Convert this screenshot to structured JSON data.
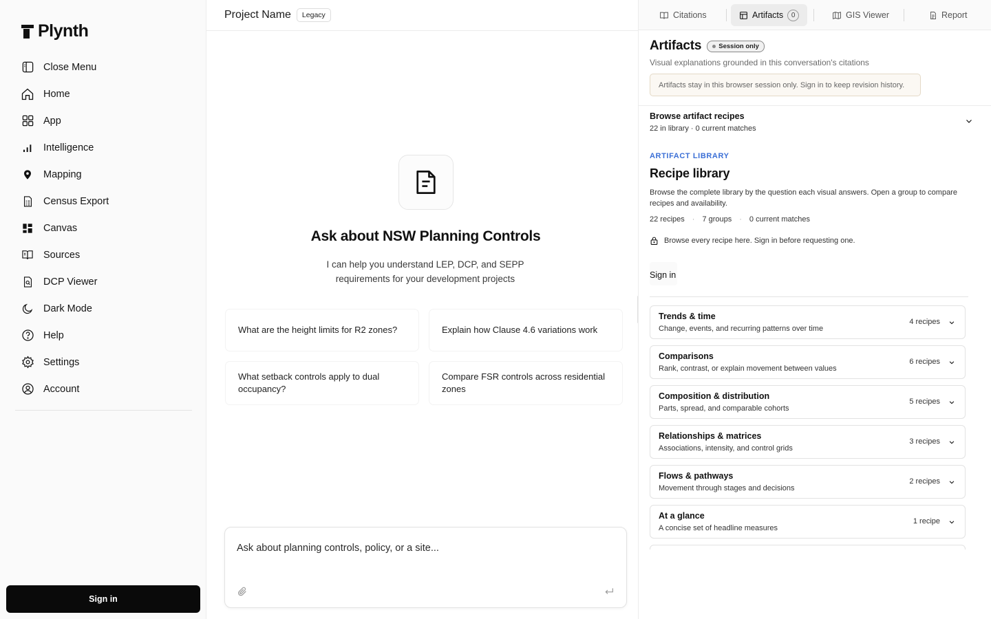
{
  "sidebar": {
    "logo": "Plynth",
    "items": [
      {
        "label": "Close Menu",
        "icon": "sidebar-toggle-icon"
      },
      {
        "label": "Home",
        "icon": "home-icon"
      },
      {
        "label": "App",
        "icon": "grid-icon"
      },
      {
        "label": "Intelligence",
        "icon": "bar-chart-icon"
      },
      {
        "label": "Mapping",
        "icon": "map-pin-icon"
      },
      {
        "label": "Census Export",
        "icon": "spreadsheet-icon"
      },
      {
        "label": "Canvas",
        "icon": "dashboard-icon"
      },
      {
        "label": "Sources",
        "icon": "book-icon"
      },
      {
        "label": "DCP Viewer",
        "icon": "file-search-icon"
      },
      {
        "label": "Dark Mode",
        "icon": "moon-icon"
      },
      {
        "label": "Help",
        "icon": "help-circle-icon"
      },
      {
        "label": "Settings",
        "icon": "gear-icon"
      },
      {
        "label": "Account",
        "icon": "user-circle-icon"
      }
    ],
    "sign_in": "Sign in"
  },
  "main": {
    "project_name": "Project Name",
    "badge": "Legacy",
    "hero_title": "Ask about NSW Planning Controls",
    "hero_subtitle": "I can help you understand LEP, DCP, and SEPP requirements for your development projects",
    "suggestions": [
      "What are the height limits for R2 zones?",
      "Explain how Clause 4.6 variations work",
      "What setback controls apply to dual occupancy?",
      "Compare FSR controls across residential zones"
    ],
    "composer_placeholder": "Ask about planning controls, policy, or a site..."
  },
  "panel": {
    "tabs": [
      {
        "label": "Citations",
        "icon": "book-open-icon"
      },
      {
        "label": "Artifacts",
        "icon": "layout-icon",
        "count": "0"
      },
      {
        "label": "GIS Viewer",
        "icon": "map-icon"
      },
      {
        "label": "Report",
        "icon": "report-icon"
      }
    ],
    "title": "Artifacts",
    "session_badge": "Session only",
    "subtitle": "Visual explanations grounded in this conversation's citations",
    "notice": "Artifacts stay in this browser session only. Sign in to keep revision history.",
    "browse_title": "Browse artifact recipes",
    "browse_sub": "22 in library · 0 current matches",
    "library_eyebrow": "ARTIFACT LIBRARY",
    "library_title": "Recipe library",
    "library_desc": "Browse the complete library by the question each visual answers. Open a group to compare recipes and availability.",
    "stats": [
      "22 recipes",
      "7 groups",
      "0 current matches"
    ],
    "lock_text": "Browse every recipe here. Sign in before requesting one.",
    "sign_in": "Sign in",
    "groups": [
      {
        "title": "Trends & time",
        "desc": "Change, events, and recurring patterns over time",
        "count": "4 recipes"
      },
      {
        "title": "Comparisons",
        "desc": "Rank, contrast, or explain movement between values",
        "count": "6 recipes"
      },
      {
        "title": "Composition & distribution",
        "desc": "Parts, spread, and comparable cohorts",
        "count": "5 recipes"
      },
      {
        "title": "Relationships & matrices",
        "desc": "Associations, intensity, and control grids",
        "count": "3 recipes"
      },
      {
        "title": "Flows & pathways",
        "desc": "Movement through stages and decisions",
        "count": "2 recipes"
      },
      {
        "title": "At a glance",
        "desc": "A concise set of headline measures",
        "count": "1 recipe"
      }
    ]
  },
  "colors": {
    "accent": "#3b6fd6",
    "primary_button": "#0a0a0a",
    "notice_bg": "#fbf8f3"
  }
}
